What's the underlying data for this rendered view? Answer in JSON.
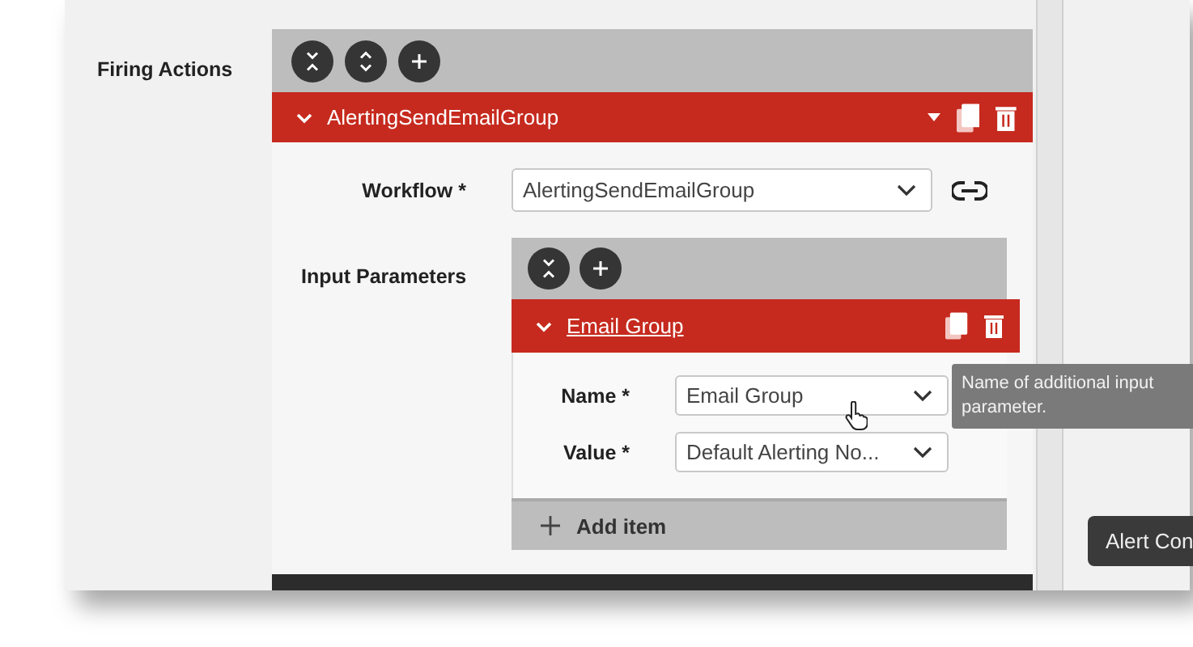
{
  "section_label": "Firing Actions",
  "toolbar": [
    {
      "kind": "collapse-all"
    },
    {
      "kind": "expand-all"
    },
    {
      "kind": "add"
    }
  ],
  "action": {
    "title": "AlertingSendEmailGroup",
    "expanded": true,
    "workflow": {
      "label": "Workflow *",
      "value": "AlertingSendEmailGroup"
    },
    "input_parameters": {
      "label": "Input Parameters",
      "toolbar": [
        {
          "kind": "collapse-all"
        },
        {
          "kind": "add"
        }
      ],
      "item": {
        "title": "Email Group",
        "expanded": true,
        "fields": [
          {
            "label": "Name *",
            "value": "Email Group"
          },
          {
            "label": "Value *",
            "value": "Default Alerting No..."
          }
        ]
      },
      "add_item": "Add item"
    }
  },
  "tooltip": "Name of additional input parameter.",
  "side_tooltip": "Alert Con"
}
